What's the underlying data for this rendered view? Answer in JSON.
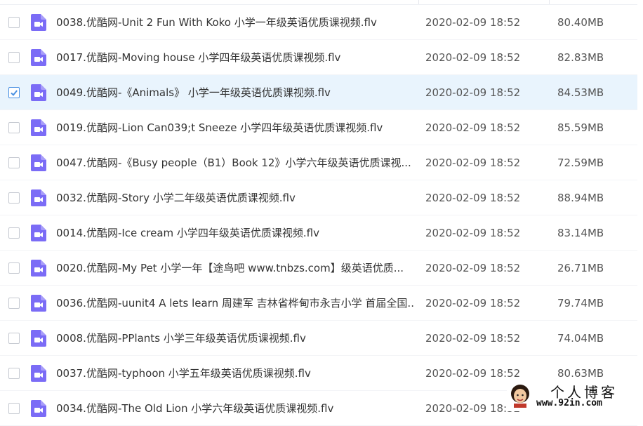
{
  "colors": {
    "selected_row": "#e9f4fd",
    "icon": "#7b6cf6",
    "check": "#4a90e2"
  },
  "files": [
    {
      "name": "0038.优酷网-Unit 2 Fun With Koko 小学一年级英语优质课视频.flv",
      "date": "2020-02-09 18:52",
      "size": "80.40MB",
      "selected": false,
      "icon": "video-file-icon"
    },
    {
      "name": "0017.优酷网-Moving house 小学四年级英语优质课视频.flv",
      "date": "2020-02-09 18:52",
      "size": "82.83MB",
      "selected": false,
      "icon": "video-file-icon"
    },
    {
      "name": "0049.优酷网-《Animals》 小学一年级英语优质课视频.flv",
      "date": "2020-02-09 18:52",
      "size": "84.53MB",
      "selected": true,
      "icon": "video-file-icon"
    },
    {
      "name": "0019.优酷网-Lion Can039;t Sneeze 小学四年级英语优质课视频.flv",
      "date": "2020-02-09 18:52",
      "size": "85.59MB",
      "selected": false,
      "icon": "video-file-icon"
    },
    {
      "name": "0047.优酷网-《Busy people（B1）Book 12》小学六年级英语优质课视...",
      "date": "2020-02-09 18:52",
      "size": "72.59MB",
      "selected": false,
      "icon": "video-file-icon"
    },
    {
      "name": "0032.优酷网-Story 小学二年级英语优质课视频.flv",
      "date": "2020-02-09 18:52",
      "size": "88.94MB",
      "selected": false,
      "icon": "video-file-icon"
    },
    {
      "name": "0014.优酷网-Ice cream 小学四年级英语优质课视频.flv",
      "date": "2020-02-09 18:52",
      "size": "83.14MB",
      "selected": false,
      "icon": "video-file-icon"
    },
    {
      "name": "0020.优酷网-My  Pet 小学一年【途鸟吧 www.tnbzs.com】级英语优质...",
      "date": "2020-02-09 18:52",
      "size": "26.71MB",
      "selected": false,
      "icon": "video-file-icon"
    },
    {
      "name": "0036.优酷网-uunit4 A lets learn 周建军 吉林省桦甸市永吉小学 首届全国...",
      "date": "2020-02-09 18:52",
      "size": "79.74MB",
      "selected": false,
      "icon": "video-file-icon"
    },
    {
      "name": "0008.优酷网-PPlants 小学三年级英语优质课视频.flv",
      "date": "2020-02-09 18:52",
      "size": "74.04MB",
      "selected": false,
      "icon": "video-file-icon"
    },
    {
      "name": "0037.优酷网-typhoon 小学五年级英语优质课视频.flv",
      "date": "2020-02-09 18:52",
      "size": "80.63MB",
      "selected": false,
      "icon": "video-file-icon"
    },
    {
      "name": "0034.优酷网-The Old Lion 小学六年级英语优质课视频.flv",
      "date": "2020-02-09 18:52",
      "size": "",
      "selected": false,
      "icon": "video-file-icon"
    }
  ],
  "watermark": {
    "title": "个人博客",
    "url": "www.92in.com"
  }
}
